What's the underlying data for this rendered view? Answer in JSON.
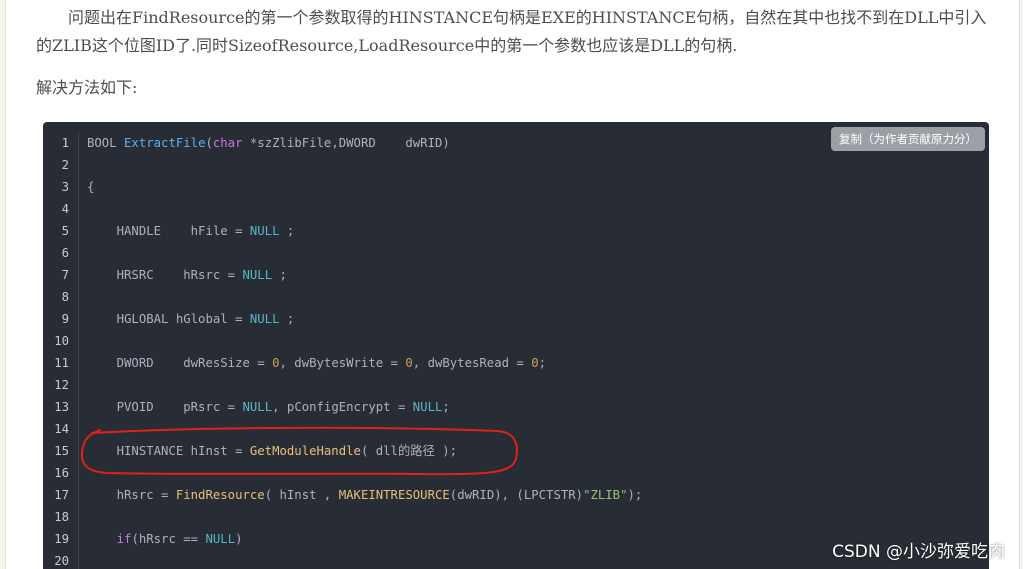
{
  "article": {
    "paragraph": "问题出在FindResource的第一个参数取得的HINSTANCE句柄是EXE的HINSTANCE句柄，自然在其中也找不到在DLL中引入的ZLIB这个位图ID了.同时SizeofResource,LoadResource中的第一个参数也应该是DLL的句柄.",
    "heading": "解决方法如下:"
  },
  "code_block": {
    "copy_label": "复制（为作者贡献原力分）",
    "lines": [
      {
        "n": "1",
        "tokens": [
          {
            "t": "BOOL ",
            "c": "plain"
          },
          {
            "t": "ExtractFile",
            "c": "fn"
          },
          {
            "t": "(",
            "c": "plain"
          },
          {
            "t": "char",
            "c": "key"
          },
          {
            "t": " *szZlibFile,DWORD    dwRID)",
            "c": "plain"
          }
        ]
      },
      {
        "n": "2",
        "tokens": []
      },
      {
        "n": "3",
        "tokens": [
          {
            "t": "{",
            "c": "plain"
          }
        ]
      },
      {
        "n": "4",
        "tokens": []
      },
      {
        "n": "5",
        "tokens": [
          {
            "t": "    HANDLE    hFile = ",
            "c": "plain"
          },
          {
            "t": "NULL",
            "c": "lit"
          },
          {
            "t": " ;",
            "c": "plain"
          }
        ]
      },
      {
        "n": "6",
        "tokens": []
      },
      {
        "n": "7",
        "tokens": [
          {
            "t": "    HRSRC    hRsrc = ",
            "c": "plain"
          },
          {
            "t": "NULL",
            "c": "lit"
          },
          {
            "t": " ;",
            "c": "plain"
          }
        ]
      },
      {
        "n": "8",
        "tokens": []
      },
      {
        "n": "9",
        "tokens": [
          {
            "t": "    HGLOBAL hGlobal = ",
            "c": "plain"
          },
          {
            "t": "NULL",
            "c": "lit"
          },
          {
            "t": " ;",
            "c": "plain"
          }
        ]
      },
      {
        "n": "10",
        "tokens": []
      },
      {
        "n": "11",
        "tokens": [
          {
            "t": "    DWORD    dwResSize = ",
            "c": "plain"
          },
          {
            "t": "0",
            "c": "num"
          },
          {
            "t": ", dwBytesWrite = ",
            "c": "plain"
          },
          {
            "t": "0",
            "c": "num"
          },
          {
            "t": ", dwBytesRead = ",
            "c": "plain"
          },
          {
            "t": "0",
            "c": "num"
          },
          {
            "t": ";",
            "c": "plain"
          }
        ]
      },
      {
        "n": "12",
        "tokens": []
      },
      {
        "n": "13",
        "tokens": [
          {
            "t": "    PVOID    pRsrc = ",
            "c": "plain"
          },
          {
            "t": "NULL",
            "c": "lit"
          },
          {
            "t": ", pConfigEncrypt = ",
            "c": "plain"
          },
          {
            "t": "NULL",
            "c": "lit"
          },
          {
            "t": ";",
            "c": "plain"
          }
        ]
      },
      {
        "n": "14",
        "tokens": []
      },
      {
        "n": "15",
        "tokens": [
          {
            "t": "    HINSTANCE hInst = ",
            "c": "plain"
          },
          {
            "t": "GetModuleHandle",
            "c": "call"
          },
          {
            "t": "( dll的路径 );",
            "c": "plain"
          }
        ]
      },
      {
        "n": "16",
        "tokens": []
      },
      {
        "n": "17",
        "tokens": [
          {
            "t": "    hRsrc = ",
            "c": "plain"
          },
          {
            "t": "FindResource",
            "c": "call"
          },
          {
            "t": "( hInst , ",
            "c": "plain"
          },
          {
            "t": "MAKEINTRESOURCE",
            "c": "call"
          },
          {
            "t": "(dwRID), (LPCTSTR)",
            "c": "plain"
          },
          {
            "t": "\"ZLIB\"",
            "c": "str"
          },
          {
            "t": ");",
            "c": "plain"
          }
        ]
      },
      {
        "n": "18",
        "tokens": []
      },
      {
        "n": "19",
        "tokens": [
          {
            "t": "    ",
            "c": "plain"
          },
          {
            "t": "if",
            "c": "key"
          },
          {
            "t": "(hRsrc == ",
            "c": "plain"
          },
          {
            "t": "NULL",
            "c": "lit"
          },
          {
            "t": ")",
            "c": "plain"
          }
        ]
      },
      {
        "n": "20",
        "tokens": []
      }
    ]
  },
  "watermark": "CSDN @小沙弥爱吃肉",
  "colors": {
    "code_bg": "#282c34",
    "annotation_red": "#e0201a",
    "function_blue": "#61aeee",
    "null_cyan": "#56b6c2",
    "number_orange": "#d19a66",
    "string_green": "#98c379"
  }
}
